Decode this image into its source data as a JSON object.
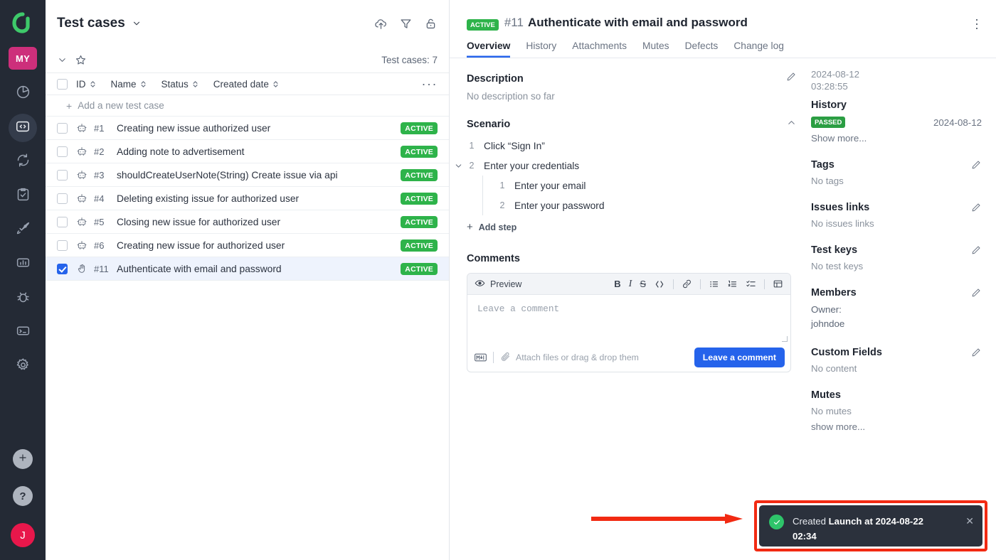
{
  "rail": {
    "logo_icon": "allure-logo-icon",
    "project_badge": "MY",
    "items": [
      {
        "name": "dashboards",
        "icon": "pie-chart-icon",
        "active": false
      },
      {
        "name": "test-cases",
        "icon": "code-brackets-icon",
        "active": true
      },
      {
        "name": "automation-runs",
        "icon": "refresh-cycle-icon",
        "active": false
      },
      {
        "name": "test-plans",
        "icon": "clipboard-check-icon",
        "active": false
      },
      {
        "name": "launches",
        "icon": "rocket-icon",
        "active": false
      },
      {
        "name": "analytics",
        "icon": "bar-chart-icon",
        "active": false
      },
      {
        "name": "defects",
        "icon": "bug-icon",
        "active": false
      },
      {
        "name": "console",
        "icon": "terminal-icon",
        "active": false
      },
      {
        "name": "settings",
        "icon": "gear-icon",
        "active": false
      }
    ],
    "add_icon": "plus-icon",
    "help_icon": "question-mark-icon",
    "avatar_initial": "J"
  },
  "list_panel": {
    "title": "Test cases",
    "title_chevron_icon": "chevron-down-icon",
    "actions": [
      {
        "name": "upload-button",
        "icon": "cloud-upload-icon"
      },
      {
        "name": "filter-button",
        "icon": "filter-funnel-icon"
      },
      {
        "name": "lock-button",
        "icon": "unlock-icon"
      }
    ],
    "subbar": {
      "collapse_icon": "chevron-down-icon",
      "star_icon": "star-icon",
      "count_label": "Test cases: 7"
    },
    "columns": [
      {
        "key": "id",
        "label": "ID"
      },
      {
        "key": "name",
        "label": "Name"
      },
      {
        "key": "status",
        "label": "Status"
      },
      {
        "key": "created_date",
        "label": "Created date"
      }
    ],
    "more_menu": "···",
    "add_row_label": "Add a new test case",
    "rows": [
      {
        "id": "#1",
        "name": "Creating new issue authorized user",
        "status": "ACTIVE",
        "type_icon": "robot-icon",
        "checked": false,
        "selected": false
      },
      {
        "id": "#2",
        "name": "Adding note to advertisement",
        "status": "ACTIVE",
        "type_icon": "robot-icon",
        "checked": false,
        "selected": false
      },
      {
        "id": "#3",
        "name": "shouldCreateUserNote(String) Create issue via api",
        "status": "ACTIVE",
        "type_icon": "robot-icon",
        "checked": false,
        "selected": false
      },
      {
        "id": "#4",
        "name": "Deleting existing issue for authorized user",
        "status": "ACTIVE",
        "type_icon": "robot-icon",
        "checked": false,
        "selected": false
      },
      {
        "id": "#5",
        "name": "Closing new issue for authorized user",
        "status": "ACTIVE",
        "type_icon": "robot-icon",
        "checked": false,
        "selected": false
      },
      {
        "id": "#6",
        "name": "Creating new issue for authorized user",
        "status": "ACTIVE",
        "type_icon": "robot-icon",
        "checked": false,
        "selected": false
      },
      {
        "id": "#11",
        "name": "Authenticate with email and password",
        "status": "ACTIVE",
        "type_icon": "hand-manual-icon",
        "checked": true,
        "selected": true
      }
    ]
  },
  "detail": {
    "status_badge": "ACTIVE",
    "number": "#11",
    "title": "Authenticate with email and password",
    "kebab_icon": "vertical-dots-icon",
    "tabs": [
      {
        "label": "Overview",
        "active": true
      },
      {
        "label": "History",
        "active": false
      },
      {
        "label": "Attachments",
        "active": false
      },
      {
        "label": "Mutes",
        "active": false
      },
      {
        "label": "Defects",
        "active": false
      },
      {
        "label": "Change log",
        "active": false
      }
    ],
    "description": {
      "title": "Description",
      "edit_icon": "pencil-icon",
      "empty_text": "No description so far"
    },
    "scenario": {
      "title": "Scenario",
      "collapse_icon": "chevron-up-icon",
      "steps": [
        {
          "n": "1",
          "text": "Click “Sign In”",
          "has_chevron": false
        },
        {
          "n": "2",
          "text": "Enter your credentials",
          "has_chevron": true,
          "children": [
            {
              "n": "1",
              "text": "Enter your email"
            },
            {
              "n": "2",
              "text": "Enter your password"
            }
          ]
        }
      ],
      "add_step_label": "Add step"
    },
    "comments": {
      "title": "Comments",
      "preview_label": "Preview",
      "preview_icon": "eye-icon",
      "tools": [
        {
          "name": "bold",
          "icon": "bold-icon",
          "glyph": "B"
        },
        {
          "name": "italic",
          "icon": "italic-icon",
          "glyph": "I"
        },
        {
          "name": "strikethrough",
          "icon": "strikethrough-icon",
          "glyph": "S"
        },
        {
          "name": "code",
          "icon": "code-icon",
          "glyph": "</>"
        },
        {
          "name": "link",
          "icon": "link-icon",
          "glyph": ""
        },
        {
          "name": "bullet-list",
          "icon": "bullet-list-icon",
          "glyph": ""
        },
        {
          "name": "numbered-list",
          "icon": "numbered-list-icon",
          "glyph": ""
        },
        {
          "name": "checklist",
          "icon": "checklist-icon",
          "glyph": ""
        },
        {
          "name": "table",
          "icon": "table-icon",
          "glyph": ""
        }
      ],
      "placeholder": "Leave a comment",
      "markdown_icon": "markdown-icon",
      "attach_icon": "paperclip-icon",
      "attach_label": "Attach files or drag & drop them",
      "submit_label": "Leave a comment"
    }
  },
  "meta": {
    "created_date": "2024-08-12",
    "created_time": "03:28:55",
    "history": {
      "title": "History",
      "status": "PASSED",
      "date": "2024-08-12",
      "show_more": "Show more..."
    },
    "sections": [
      {
        "title": "Tags",
        "value": "No tags",
        "edit_icon": "pencil-icon",
        "editable": true
      },
      {
        "title": "Issues links",
        "value": "No issues links",
        "edit_icon": "pencil-icon",
        "editable": true
      },
      {
        "title": "Test keys",
        "value": "No test keys",
        "edit_icon": "pencil-icon",
        "editable": true
      }
    ],
    "members": {
      "title": "Members",
      "edit_icon": "pencil-icon",
      "owner_label": "Owner:",
      "owner_name": "johndoe"
    },
    "custom_fields": {
      "title": "Custom Fields",
      "edit_icon": "pencil-icon",
      "value": "No content"
    },
    "mutes": {
      "title": "Mutes",
      "value": "No mutes",
      "show_more": "show more..."
    }
  },
  "annotation": {
    "arrow_color": "#f22a12",
    "highlight_color": "#f22a12"
  },
  "toast": {
    "check_icon": "check-circle-icon",
    "prefix": "Created ",
    "strong": "Launch at 2024-08-22 02:34",
    "close_icon": "close-icon"
  },
  "colors": {
    "accent_blue": "#2563eb",
    "status_green": "#2eb34a",
    "rail_bg": "#242a35",
    "brand_pink": "#cd2f7b",
    "avatar_red": "#e8174b"
  }
}
